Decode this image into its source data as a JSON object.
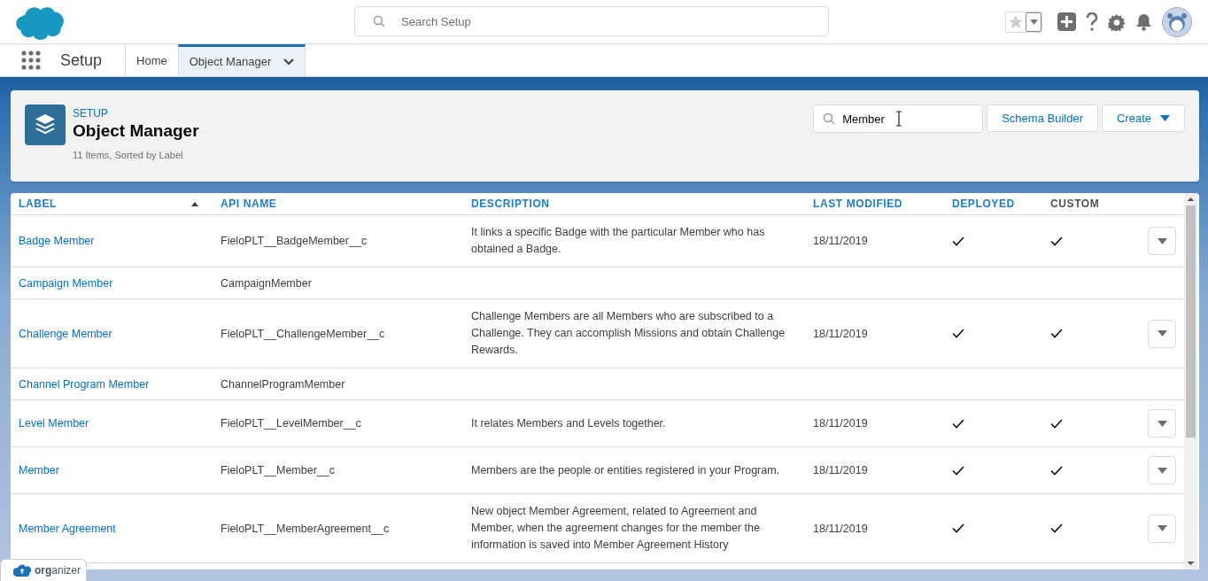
{
  "header": {
    "search": {
      "placeholder": "Search Setup"
    }
  },
  "nav": {
    "app_name": "Setup",
    "tabs": [
      {
        "label": "Home",
        "selected": false,
        "has_menu": false
      },
      {
        "label": "Object Manager",
        "selected": true,
        "has_menu": true
      }
    ]
  },
  "page": {
    "breadcrumb": "SETUP",
    "title": "Object Manager",
    "summary": "11 Items, Sorted by Label",
    "search": {
      "value": "Member"
    },
    "buttons": [
      {
        "label": "Schema Builder",
        "kind": "plain"
      },
      {
        "label": "Create",
        "kind": "menu"
      }
    ]
  },
  "table": {
    "columns": [
      {
        "label": "LABEL",
        "sortable": true,
        "sorted": true
      },
      {
        "label": "API NAME",
        "sortable": true,
        "sorted": false
      },
      {
        "label": "DESCRIPTION",
        "sortable": true,
        "sorted": false
      },
      {
        "label": "LAST MODIFIED",
        "sortable": true,
        "sorted": false
      },
      {
        "label": "DEPLOYED",
        "sortable": true,
        "sorted": false
      },
      {
        "label": "CUSTOM",
        "sortable": false,
        "sorted": false
      }
    ],
    "rows": [
      {
        "label": "Badge Member",
        "api_name": "FieloPLT__BadgeMember__c",
        "description": "It links a specific Badge with the particular Member who has obtained a Badge.",
        "last_modified": "18/11/2019",
        "deployed": true,
        "custom": true,
        "has_actions": true
      },
      {
        "label": "Campaign Member",
        "api_name": "CampaignMember",
        "deployed": false,
        "custom": false,
        "has_actions": false
      },
      {
        "label": "Challenge Member",
        "api_name": "FieloPLT__ChallengeMember__c",
        "description": "Challenge Members are all Members who are subscribed to a Challenge. They can accomplish Missions and obtain Challenge Rewards.",
        "last_modified": "18/11/2019",
        "deployed": true,
        "custom": true,
        "has_actions": true
      },
      {
        "label": "Channel Program Member",
        "api_name": "ChannelProgramMember",
        "deployed": false,
        "custom": false,
        "has_actions": false
      },
      {
        "label": "Level Member",
        "api_name": "FieloPLT__LevelMember__c",
        "description": "It relates Members and Levels together.",
        "last_modified": "18/11/2019",
        "deployed": true,
        "custom": true,
        "has_actions": true
      },
      {
        "label": "Member",
        "api_name": "FieloPLT__Member__c",
        "description": "Members are the people or entities registered in your Program.",
        "last_modified": "18/11/2019",
        "deployed": true,
        "custom": true,
        "has_actions": true
      },
      {
        "label": "Member Agreement",
        "api_name": "FieloPLT__MemberAgreement__c",
        "description": "New object Member Agreement, related to Agreement and Member, when the agreement changes for the member the information is saved into Member Agreement History",
        "last_modified": "18/11/2019",
        "deployed": true,
        "custom": true,
        "has_actions": true
      }
    ]
  },
  "footer_tab": {
    "label": "**org**anizer"
  }
}
